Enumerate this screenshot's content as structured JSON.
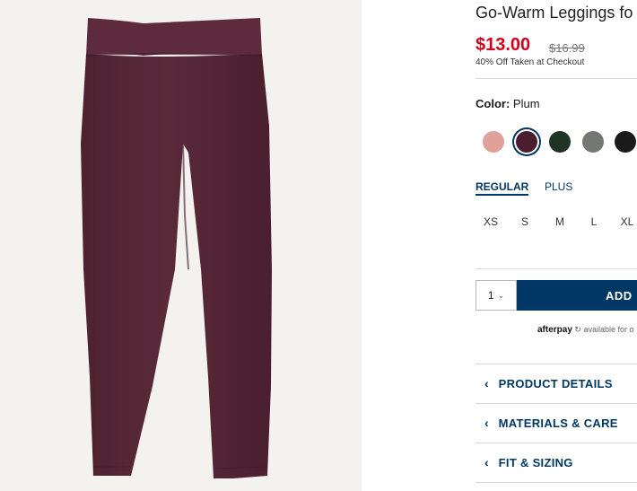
{
  "product": {
    "title": "Go-Warm Leggings fo",
    "price": "$13.00",
    "original_price": "$16.99",
    "discount_note": "40% Off Taken at Checkout"
  },
  "color": {
    "label": "Color:",
    "selected": "Plum",
    "swatches": [
      {
        "name": "pink",
        "hex": "#e1a09a"
      },
      {
        "name": "plum",
        "hex": "#4a1e2e",
        "selected": true
      },
      {
        "name": "dark-green",
        "hex": "#1f3327"
      },
      {
        "name": "gray",
        "hex": "#737873"
      },
      {
        "name": "black",
        "hex": "#1a1a1a"
      }
    ]
  },
  "size_tabs": {
    "regular": "REGULAR",
    "plus": "PLUS"
  },
  "sizes": [
    "XS",
    "S",
    "M",
    "L",
    "XL"
  ],
  "quantity": {
    "value": "1",
    "chevron": "⌄"
  },
  "add_button": {
    "label": "ADD"
  },
  "afterpay": {
    "brand": "afterpay",
    "text": "available for o"
  },
  "accordion": {
    "chevron": "‹",
    "product_details": "PRODUCT DETAILS",
    "materials_care": "MATERIALS & CARE",
    "fit_sizing": "FIT & SIZING"
  },
  "colors": {
    "accent": "#003764",
    "sale": "#d0021b",
    "plum": "#4a1e2e",
    "image_bg": "#f4f2ef"
  }
}
